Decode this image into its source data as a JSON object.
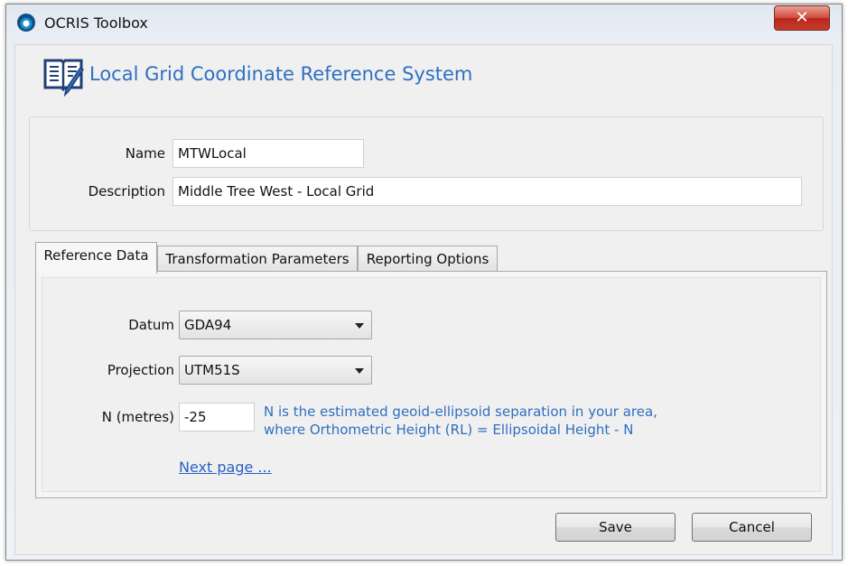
{
  "window": {
    "title": "OCRIS Toolbox",
    "close_label": "✕"
  },
  "header": {
    "title": "Local Grid Coordinate Reference System"
  },
  "form": {
    "name_label": "Name",
    "name_value": "MTWLocal",
    "description_label": "Description",
    "description_value": "Middle Tree West - Local Grid"
  },
  "tabs": [
    {
      "label": "Reference Data",
      "active": true
    },
    {
      "label": "Transformation Parameters",
      "active": false
    },
    {
      "label": "Reporting Options",
      "active": false
    }
  ],
  "reference": {
    "datum_label": "Datum",
    "datum_value": "GDA94",
    "projection_label": "Projection",
    "projection_value": "UTM51S",
    "n_label": "N (metres)",
    "n_value": "-25",
    "hint_line1": "N is the estimated geoid-ellipsoid separation in your area,",
    "hint_line2": "where Orthometric Height (RL) = Ellipsoidal Height - N",
    "next_link": "Next page ..."
  },
  "buttons": {
    "save": "Save",
    "cancel": "Cancel"
  },
  "icons": {
    "app": "ocris-app-icon",
    "header": "book-edit-icon"
  },
  "colors": {
    "accent": "#2f6fc1",
    "link": "#2a5fc4"
  }
}
